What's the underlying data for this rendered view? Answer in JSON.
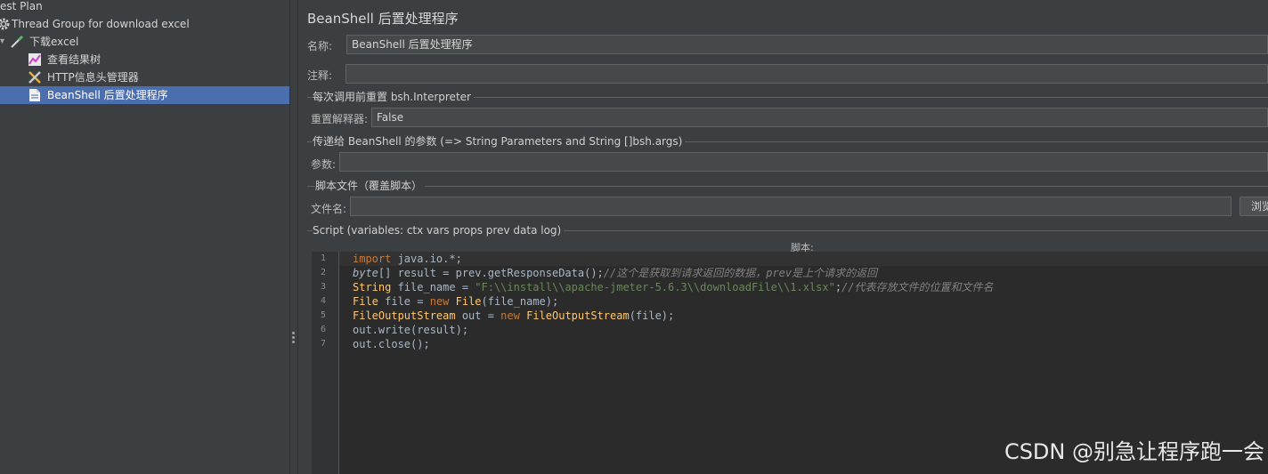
{
  "tree": {
    "items": [
      {
        "label": "est Plan"
      },
      {
        "label": "Thread Group for download excel"
      },
      {
        "label": "下载excel"
      },
      {
        "label": "查看结果树"
      },
      {
        "label": "HTTP信息头管理器"
      },
      {
        "label": "BeanShell 后置处理程序"
      }
    ]
  },
  "panel": {
    "title": "BeanShell 后置处理程序",
    "name_label": "名称:",
    "name_value": "BeanShell 后置处理程序",
    "comment_label": "注释:",
    "comment_value": "",
    "reset_section": "每次调用前重置 bsh.Interpreter",
    "reset_label": "重置解释器:",
    "reset_value": "False",
    "params_section": "传递给 BeanShell 的参数 (=> String Parameters and String []bsh.args)",
    "params_label": "参数:",
    "params_value": "",
    "file_section": "脚本文件（覆盖脚本）",
    "file_label": "文件名:",
    "file_value": "",
    "browse_button": "浏览",
    "script_section": "Script (variables: ctx vars props prev data log)",
    "script_header": "脚本:"
  },
  "editor": {
    "line_numbers": [
      "1",
      "2",
      "3",
      "4",
      "5",
      "6",
      "7"
    ],
    "lines": [
      [
        {
          "t": "import",
          "c": "kw"
        },
        {
          "t": " java.io.*;",
          "c": ""
        }
      ],
      [
        {
          "t": "byte",
          "c": "kw it"
        },
        {
          "t": "[] result = prev.getResponseData();",
          "c": ""
        },
        {
          "t": "//这个是获取到请求返回的数据，prev是上个请求的返回",
          "c": "cm"
        }
      ],
      [
        {
          "t": "String",
          "c": "ty"
        },
        {
          "t": " file_name = ",
          "c": ""
        },
        {
          "t": "\"F:\\\\install\\\\apache-jmeter-5.6.3\\\\downloadFile\\\\1.xlsx\"",
          "c": "st"
        },
        {
          "t": ";",
          "c": ""
        },
        {
          "t": "//代表存放文件的位置和文件名",
          "c": "cm"
        }
      ],
      [
        {
          "t": "File",
          "c": "ty"
        },
        {
          "t": " file = ",
          "c": ""
        },
        {
          "t": "new",
          "c": "kw"
        },
        {
          "t": " ",
          "c": ""
        },
        {
          "t": "File",
          "c": "ty"
        },
        {
          "t": "(file_name);",
          "c": ""
        }
      ],
      [
        {
          "t": "FileOutputStream",
          "c": "ty"
        },
        {
          "t": " out = ",
          "c": ""
        },
        {
          "t": "new",
          "c": "kw"
        },
        {
          "t": " ",
          "c": ""
        },
        {
          "t": "FileOutputStream",
          "c": "ty"
        },
        {
          "t": "(file);",
          "c": ""
        }
      ],
      [
        {
          "t": "out.write(result);",
          "c": ""
        }
      ],
      [
        {
          "t": "out.close();",
          "c": ""
        }
      ]
    ]
  },
  "watermark": "CSDN @别急让程序跑一会",
  "colors": {
    "background": "#3c3f41",
    "selection": "#4b6eaf",
    "keyword": "#cc7832",
    "type": "#ffc66d",
    "string": "#6a8759",
    "comment": "#808080"
  }
}
